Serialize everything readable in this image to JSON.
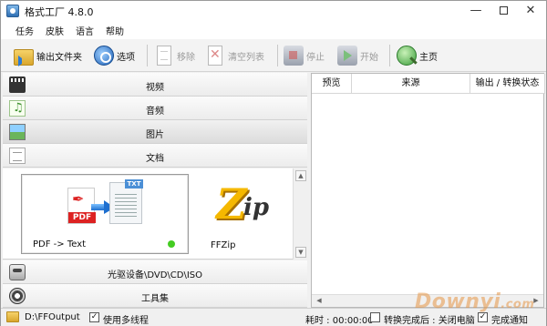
{
  "window": {
    "title": "格式工厂 4.8.0",
    "min": "—",
    "close": "✕"
  },
  "menu": [
    "任务",
    "皮肤",
    "语言",
    "帮助"
  ],
  "toolbar": {
    "output_folder": "输出文件夹",
    "options": "选项",
    "remove": "移除",
    "clear_list": "清空列表",
    "stop": "停止",
    "start": "开始",
    "home": "主页"
  },
  "categories": {
    "video": "视频",
    "audio": "音频",
    "picture": "图片",
    "document": "文档",
    "disc": "光驱设备\\DVD\\CD\\ISO",
    "tools": "工具集"
  },
  "tiles": [
    {
      "label": "PDF -> Text",
      "status_color": "#44cc22"
    },
    {
      "label": "FFZip"
    }
  ],
  "tile_art": {
    "pdf_tag": "PDF",
    "txt_tag": "TXT",
    "zip_big": "Z",
    "zip_small": "ip"
  },
  "task_table": {
    "headers": [
      "预览",
      "来源",
      "输出 / 转换状态"
    ]
  },
  "statusbar": {
    "output_path": "D:\\FFOutput",
    "multithread_label": "使用多线程",
    "multithread_checked": true,
    "elapsed_label": "耗时 : 00:00:00",
    "after_convert_label": "转换完成后 : 关闭电脑",
    "after_convert_checked": false,
    "notify_label": "完成通知",
    "notify_checked": true,
    "check_mark": "✓"
  },
  "watermark": {
    "main": "Downyi",
    "suffix": ".com"
  },
  "icons": {
    "output_folder": "folder-icon",
    "options": "options-icon",
    "remove": "remove-icon",
    "clear_list": "clear-list-icon",
    "stop": "stop-icon",
    "start": "start-icon",
    "home": "home-icon"
  }
}
